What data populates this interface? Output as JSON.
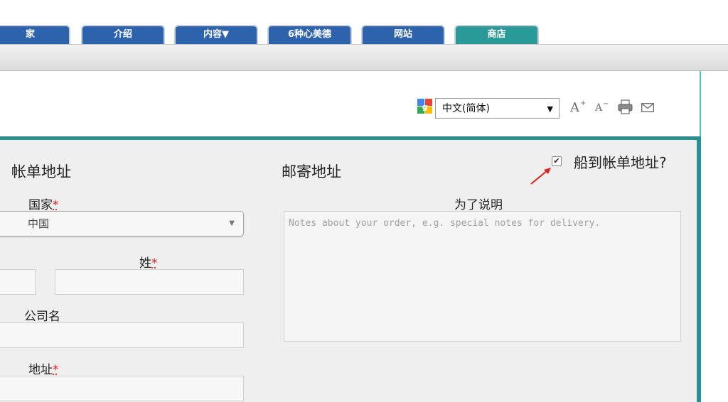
{
  "nav": {
    "tabs": [
      {
        "label": "家"
      },
      {
        "label": "介绍"
      },
      {
        "label": "内容▼"
      },
      {
        "label": "6种心美德"
      },
      {
        "label": "网站"
      },
      {
        "label": "商店"
      }
    ]
  },
  "header": {
    "language_select": {
      "value": "中文(简体)",
      "arrow": "▼"
    },
    "tools": [
      "font-increase-icon",
      "font-decrease-icon",
      "print-icon",
      "email-icon"
    ]
  },
  "billing": {
    "heading": "帐单地址",
    "country_label": "国家",
    "country_value": "中国",
    "country_caret": "▼",
    "lastname_label": "姓",
    "company_label": "公司名",
    "address_label": "地址",
    "required_mark": "*"
  },
  "shipping": {
    "heading": "邮寄地址",
    "ship_to_billing_label": "船到帐单地址?",
    "ship_to_billing_checked": true,
    "check_glyph": "✔",
    "notes_label": "为了说明",
    "notes_placeholder": "Notes about your order, e.g. special notes for delivery."
  },
  "colors": {
    "tab_blue": "#2d62ad",
    "tab_teal": "#2a9a98",
    "frame_teal": "#2a9090",
    "required_red": "#e01b1b"
  }
}
